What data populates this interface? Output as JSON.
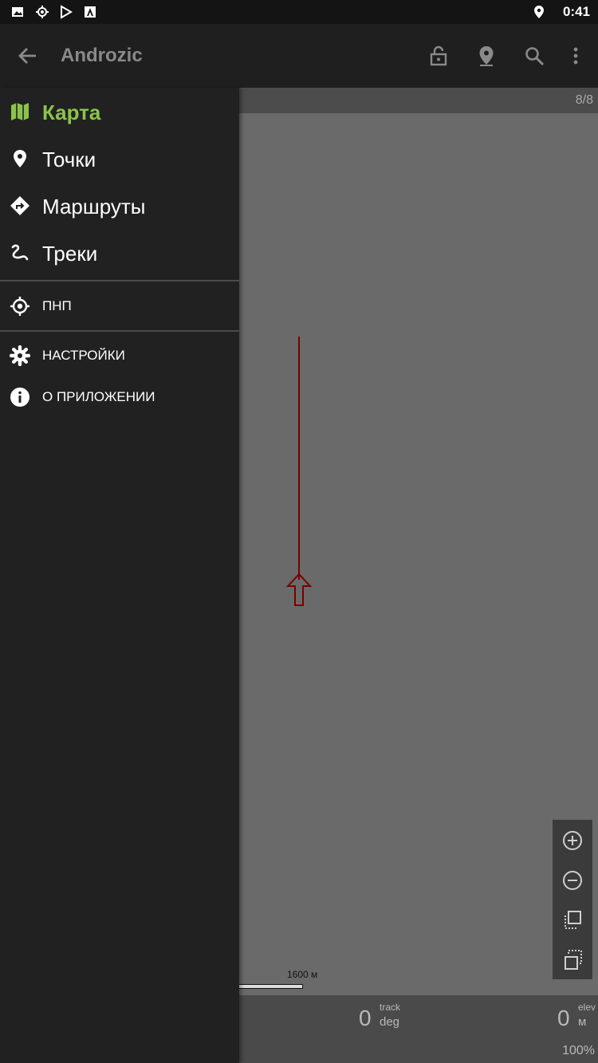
{
  "status_bar": {
    "time": "0:41",
    "left_icons": [
      "image-icon",
      "gps-icon",
      "play-store-icon",
      "font-a-icon"
    ],
    "right_icons": [
      "location-pin-icon"
    ]
  },
  "app_bar": {
    "title": "Androzic",
    "actions": [
      "lock-icon",
      "location-icon",
      "search-icon",
      "overflow-menu-icon"
    ]
  },
  "map": {
    "page_counter": "8/8",
    "scale_label": "1600 м",
    "track_color": "#7a0000"
  },
  "drawer": {
    "items": [
      {
        "label": "Карта",
        "icon": "map-icon",
        "active": true
      },
      {
        "label": "Точки",
        "icon": "waypoint-icon",
        "active": false
      },
      {
        "label": "Маршруты",
        "icon": "route-icon",
        "active": false
      },
      {
        "label": "Треки",
        "icon": "track-icon",
        "active": false
      }
    ],
    "small_items": [
      {
        "label": "ПНП",
        "icon": "crosshair-icon"
      },
      {
        "label": "НАСТРОЙКИ",
        "icon": "settings-icon"
      },
      {
        "label": "О ПРИЛОЖЕНИИ",
        "icon": "info-icon"
      }
    ],
    "accent_color": "#8bc34a"
  },
  "info_bar": {
    "track_value": "0",
    "track_label": "track",
    "track_unit": "deg",
    "elev_value": "0",
    "elev_label": "elev",
    "elev_unit": "м",
    "zoom_percent": "100%"
  }
}
